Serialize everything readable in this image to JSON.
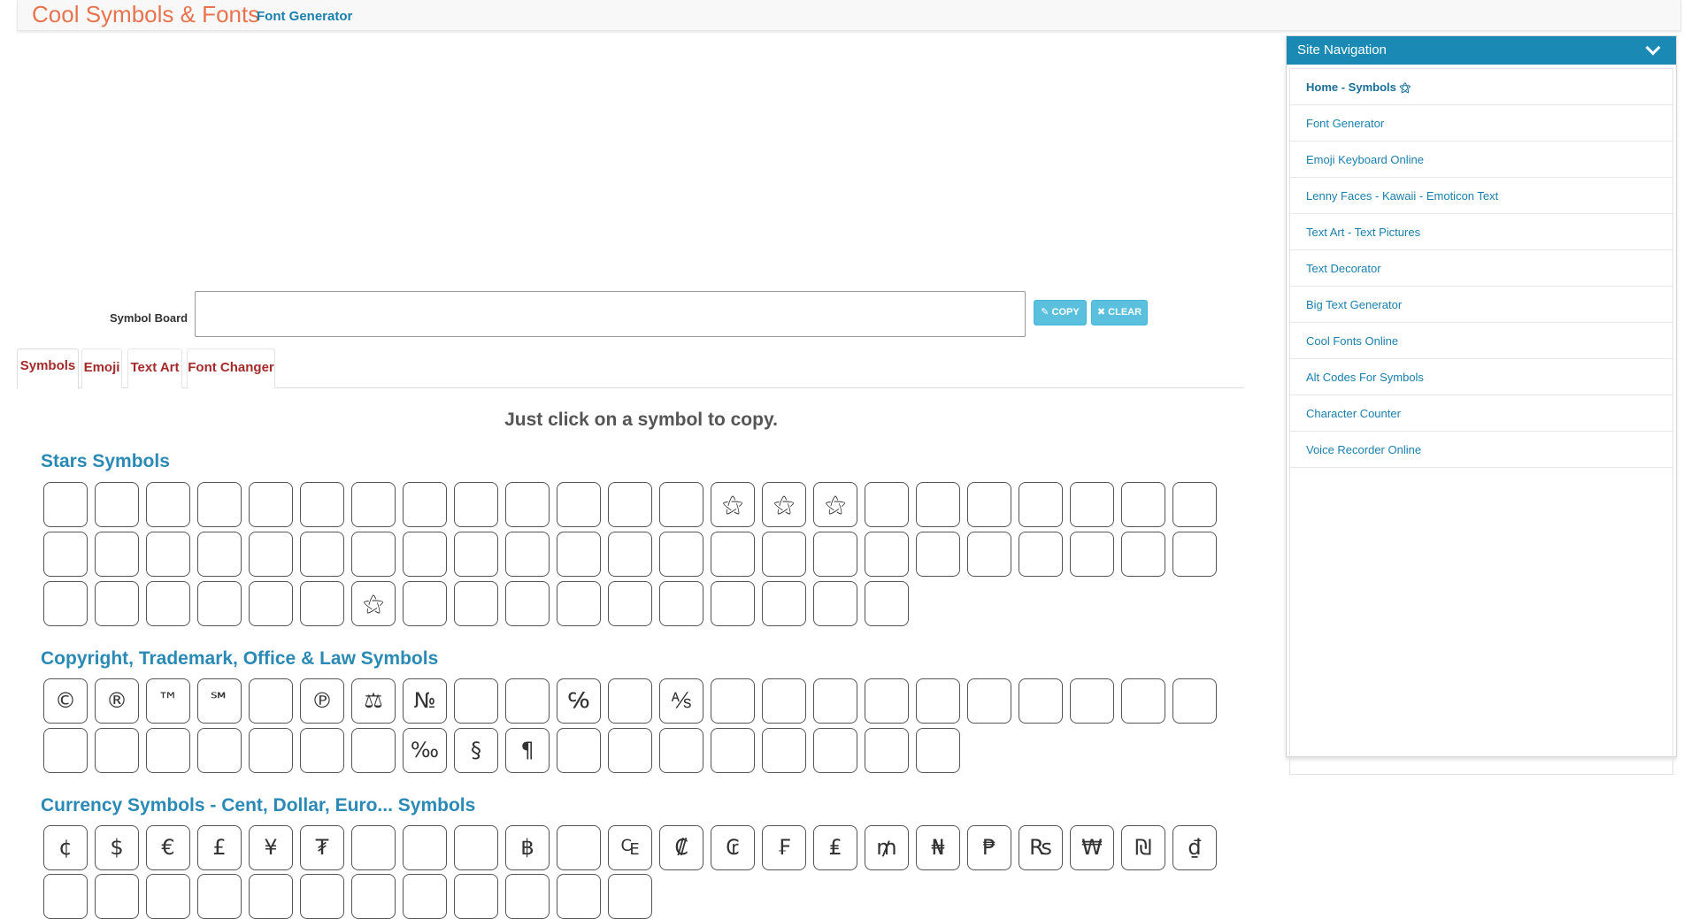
{
  "header": {
    "brand": "Cool Symbols & Fonts",
    "subtitle": "Font Generator"
  },
  "board": {
    "label": "Symbol Board",
    "value": "",
    "copy_label": "✎ COPY",
    "clear_label": "✖ CLEAR"
  },
  "tabs": [
    {
      "label": "Symbols",
      "active": true
    },
    {
      "label": "Emoji",
      "active": false
    },
    {
      "label": "Text Art",
      "active": false
    },
    {
      "label": "Font Changer",
      "active": false
    }
  ],
  "instruction": "Just click on a symbol to copy.",
  "sections": [
    {
      "title": "Stars Symbols",
      "rows": [
        [
          "",
          "",
          "",
          "",
          "",
          "",
          "",
          "",
          "",
          "",
          "",
          "",
          "",
          "⚝",
          "⚝",
          "⚝",
          "",
          "",
          "",
          "",
          "",
          "",
          ""
        ],
        [
          "",
          "",
          "",
          "",
          "",
          "",
          "",
          "",
          "",
          "",
          "",
          "",
          "",
          "",
          "",
          "",
          "",
          "",
          "",
          "",
          "",
          "",
          ""
        ],
        [
          "",
          "",
          "",
          "",
          "",
          "",
          "⚝",
          "",
          "",
          "",
          "",
          "",
          "",
          "",
          "",
          "",
          ""
        ]
      ]
    },
    {
      "title": "Copyright, Trademark, Office & Law Symbols",
      "rows": [
        [
          "©",
          "®",
          "™",
          "℠",
          "",
          "℗",
          "⚖",
          "№",
          "",
          "",
          "℅",
          "",
          "⅍",
          "",
          "",
          "",
          "",
          "",
          "",
          "",
          "",
          "",
          ""
        ],
        [
          "",
          "",
          "",
          "",
          "",
          "",
          "",
          "‰",
          "§",
          "¶",
          "",
          "",
          "",
          "",
          "",
          "",
          "",
          ""
        ]
      ]
    },
    {
      "title": "Currency Symbols - Cent, Dollar, Euro... Symbols",
      "rows": [
        [
          "¢",
          "$",
          "€",
          "£",
          "¥",
          "₮",
          "",
          "",
          "",
          "฿",
          "",
          "₠",
          "₡",
          "₢",
          "₣",
          "₤",
          "₥",
          "₦",
          "₱",
          "₨",
          "₩",
          "₪",
          "₫"
        ],
        [
          "",
          "",
          "",
          "",
          "",
          "",
          "",
          "",
          "",
          "",
          "",
          ""
        ]
      ]
    }
  ],
  "nav": {
    "title": "Site Navigation",
    "items": [
      {
        "label": "Home - Symbols ⚝",
        "active": true
      },
      {
        "label": "Font Generator",
        "active": false
      },
      {
        "label": "Emoji Keyboard Online",
        "active": false
      },
      {
        "label": "Lenny Faces - Kawaii - Emoticon Text",
        "active": false
      },
      {
        "label": "Text Art - Text Pictures",
        "active": false
      },
      {
        "label": "Text Decorator",
        "active": false
      },
      {
        "label": "Big Text Generator",
        "active": false
      },
      {
        "label": "Cool Fonts Online",
        "active": false
      },
      {
        "label": "Alt Codes For Symbols",
        "active": false
      },
      {
        "label": "Character Counter",
        "active": false
      },
      {
        "label": "Voice Recorder Online",
        "active": false
      }
    ]
  }
}
